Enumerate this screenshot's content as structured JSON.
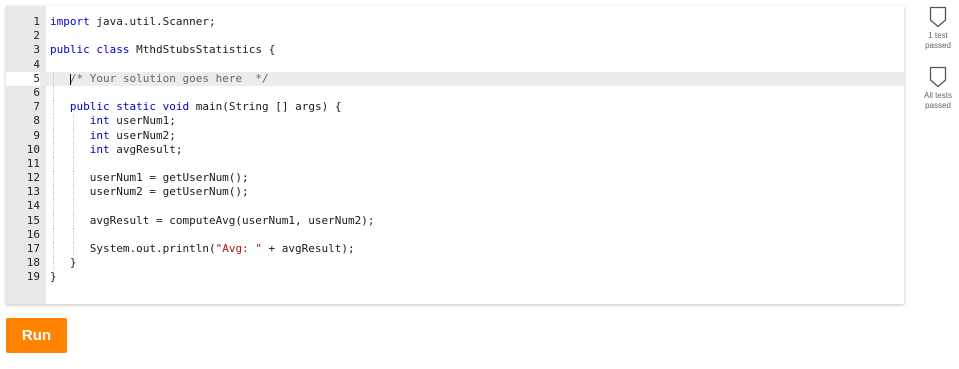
{
  "editor": {
    "lines": [
      {
        "num": "1",
        "tokens": [
          [
            "kw",
            "import"
          ],
          [
            "",
            " java.util.Scanner;"
          ]
        ]
      },
      {
        "num": "2",
        "tokens": []
      },
      {
        "num": "3",
        "tokens": [
          [
            "kw",
            "public"
          ],
          [
            "",
            " "
          ],
          [
            "kw",
            "class"
          ],
          [
            "",
            " MthdStubsStatistics {"
          ]
        ]
      },
      {
        "num": "4",
        "tokens": []
      },
      {
        "num": "5",
        "tokens": [
          [
            "",
            "   "
          ],
          [
            "cm",
            "/* Your solution goes here  */"
          ]
        ]
      },
      {
        "num": "6",
        "tokens": []
      },
      {
        "num": "7",
        "tokens": [
          [
            "",
            "   "
          ],
          [
            "kw",
            "public"
          ],
          [
            "",
            " "
          ],
          [
            "kw",
            "static"
          ],
          [
            "",
            " "
          ],
          [
            "kw",
            "void"
          ],
          [
            "",
            " main(String [] args) {"
          ]
        ]
      },
      {
        "num": "8",
        "tokens": [
          [
            "",
            "      "
          ],
          [
            "kw",
            "int"
          ],
          [
            "",
            " userNum1;"
          ]
        ]
      },
      {
        "num": "9",
        "tokens": [
          [
            "",
            "      "
          ],
          [
            "kw",
            "int"
          ],
          [
            "",
            " userNum2;"
          ]
        ]
      },
      {
        "num": "10",
        "tokens": [
          [
            "",
            "      "
          ],
          [
            "kw",
            "int"
          ],
          [
            "",
            " avgResult;"
          ]
        ]
      },
      {
        "num": "11",
        "tokens": []
      },
      {
        "num": "12",
        "tokens": [
          [
            "",
            "      userNum1 = getUserNum();"
          ]
        ]
      },
      {
        "num": "13",
        "tokens": [
          [
            "",
            "      userNum2 = getUserNum();"
          ]
        ]
      },
      {
        "num": "14",
        "tokens": []
      },
      {
        "num": "15",
        "tokens": [
          [
            "",
            "      avgResult = computeAvg(userNum1, userNum2);"
          ]
        ]
      },
      {
        "num": "16",
        "tokens": []
      },
      {
        "num": "17",
        "tokens": [
          [
            "",
            "      System.out.println("
          ],
          [
            "str",
            "\"Avg: \""
          ],
          [
            "",
            " + avgResult);"
          ]
        ]
      },
      {
        "num": "18",
        "tokens": [
          [
            "",
            "   }"
          ]
        ]
      },
      {
        "num": "19",
        "tokens": [
          [
            "",
            "}"
          ]
        ]
      }
    ],
    "active_line": "5"
  },
  "tests": [
    {
      "label_line1": "1 test",
      "label_line2": "passed",
      "icon": "shield-outline-icon"
    },
    {
      "label_line1": "All tests",
      "label_line2": "passed",
      "icon": "shield-outline-icon"
    }
  ],
  "run_button": {
    "label": "Run",
    "color": "#ff8200"
  },
  "colors": {
    "keyword": "#0000cc",
    "comment": "#666666",
    "gutter": "#e8e8e8",
    "active_line": "#ececec"
  }
}
